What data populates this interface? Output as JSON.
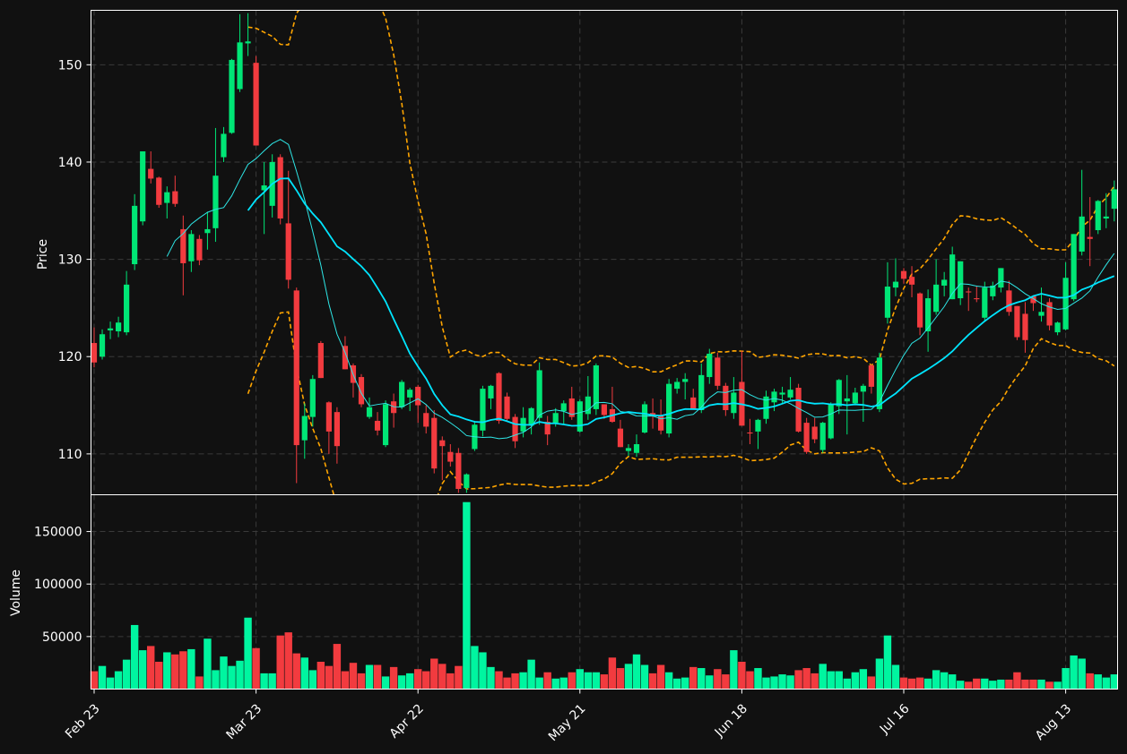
{
  "chart_data": {
    "type": "candlestick",
    "price_panel": {
      "ylabel": "Price",
      "ylim": [
        105.8,
        155.6
      ],
      "yticks": [
        110,
        120,
        130,
        140,
        150
      ],
      "grid": true,
      "overlays": [
        "moving-average-fast",
        "moving-average-slow",
        "bollinger-upper",
        "bollinger-lower"
      ]
    },
    "volume_panel": {
      "ylabel": "Volume",
      "ylim": [
        0,
        185000
      ],
      "yticks": [
        50000,
        100000,
        150000
      ],
      "grid": true
    },
    "x_tick_labels": [
      "Feb 23",
      "Mar 23",
      "Apr 22",
      "May 21",
      "Jun 18",
      "Jul 16",
      "Aug 13"
    ],
    "x_tick_index": [
      0,
      20,
      40,
      60,
      80,
      100,
      120
    ],
    "colors": {
      "background": "#111111",
      "up": "#00e676",
      "up_volume": "#00f5a0",
      "down": "#f23b3f",
      "ma_fast": "#2ee6e6",
      "ma_slow": "#00e5ff",
      "bollinger": "#ffa500",
      "grid": "#3a3a3a",
      "axis": "#ffffff"
    },
    "candles": [
      [
        121.4,
        123.0,
        118.9,
        119.4,
        17000
      ],
      [
        120.0,
        122.8,
        119.7,
        122.3,
        22000
      ],
      [
        122.7,
        123.6,
        121.8,
        122.9,
        11000
      ],
      [
        122.6,
        124.1,
        122.0,
        123.5,
        17000
      ],
      [
        122.5,
        128.8,
        122.2,
        127.4,
        28000
      ],
      [
        129.5,
        136.7,
        128.9,
        135.5,
        61000
      ],
      [
        133.9,
        141.1,
        133.5,
        141.1,
        37000
      ],
      [
        139.3,
        141.1,
        137.8,
        138.3,
        41000
      ],
      [
        138.4,
        138.5,
        135.3,
        135.6,
        26000
      ],
      [
        135.8,
        137.5,
        134.2,
        136.9,
        35000
      ],
      [
        137.0,
        138.6,
        135.4,
        135.7,
        33000
      ],
      [
        133.1,
        134.5,
        126.3,
        129.6,
        36000
      ],
      [
        129.8,
        133.0,
        128.7,
        132.6,
        38000
      ],
      [
        132.1,
        132.5,
        129.4,
        129.9,
        12000
      ],
      [
        132.7,
        134.9,
        131.0,
        133.1,
        48000
      ],
      [
        133.2,
        143.5,
        131.8,
        138.6,
        18000
      ],
      [
        140.5,
        143.6,
        140.0,
        142.9,
        31000
      ],
      [
        143.0,
        150.6,
        142.9,
        150.5,
        22000
      ],
      [
        147.5,
        155.2,
        147.2,
        152.3,
        27000
      ],
      [
        152.2,
        155.3,
        150.9,
        152.4,
        68000
      ],
      [
        150.2,
        150.9,
        141.7,
        141.7,
        39000
      ],
      [
        137.1,
        140.0,
        132.6,
        137.6,
        15000
      ],
      [
        135.5,
        140.8,
        134.3,
        140.0,
        15000
      ],
      [
        140.5,
        140.8,
        133.6,
        134.2,
        51000
      ],
      [
        133.7,
        139.1,
        127.0,
        127.9,
        54000
      ],
      [
        126.8,
        127.1,
        107.0,
        110.9,
        34000
      ],
      [
        111.4,
        115.2,
        109.5,
        113.9,
        30000
      ],
      [
        113.8,
        118.1,
        112.8,
        117.7,
        18000
      ],
      [
        121.4,
        121.6,
        117.8,
        117.8,
        26000
      ],
      [
        115.3,
        115.4,
        110.0,
        112.3,
        22000
      ],
      [
        114.3,
        114.8,
        109.0,
        110.8,
        43000
      ],
      [
        121.1,
        122.1,
        118.7,
        118.7,
        17000
      ],
      [
        119.1,
        119.3,
        115.8,
        117.3,
        25000
      ],
      [
        117.9,
        118.2,
        114.8,
        115.1,
        15000
      ],
      [
        113.8,
        115.8,
        113.6,
        114.8,
        23000
      ],
      [
        113.4,
        114.3,
        111.9,
        112.4,
        23000
      ],
      [
        110.9,
        115.5,
        110.7,
        115.1,
        12000
      ],
      [
        115.4,
        116.2,
        112.7,
        114.2,
        21000
      ],
      [
        114.8,
        117.6,
        114.6,
        117.4,
        13000
      ],
      [
        115.8,
        116.8,
        114.4,
        116.6,
        15000
      ],
      [
        116.9,
        117.1,
        113.2,
        115.0,
        19000
      ],
      [
        114.2,
        115.0,
        112.1,
        112.8,
        17000
      ],
      [
        113.7,
        114.5,
        108.0,
        108.5,
        29000
      ],
      [
        111.4,
        111.8,
        107.3,
        110.8,
        24000
      ],
      [
        110.2,
        111.0,
        108.7,
        109.2,
        15000
      ],
      [
        110.1,
        110.6,
        106.0,
        106.4,
        22000
      ],
      [
        106.5,
        108.0,
        106.0,
        107.9,
        178000
      ],
      [
        110.5,
        113.4,
        110.3,
        113.0,
        41000
      ],
      [
        112.4,
        117.0,
        111.8,
        116.7,
        35000
      ],
      [
        115.7,
        117.1,
        114.6,
        117.0,
        21000
      ],
      [
        118.3,
        118.4,
        113.1,
        113.4,
        17000
      ],
      [
        115.9,
        116.3,
        113.4,
        113.6,
        11000
      ],
      [
        113.8,
        114.1,
        110.6,
        111.3,
        15000
      ],
      [
        112.3,
        114.8,
        111.7,
        113.7,
        16000
      ],
      [
        112.9,
        114.8,
        112.0,
        114.7,
        28000
      ],
      [
        113.7,
        119.4,
        113.0,
        118.6,
        11000
      ],
      [
        113.3,
        113.9,
        110.9,
        112.0,
        16000
      ],
      [
        113.2,
        114.7,
        112.8,
        114.2,
        10000
      ],
      [
        114.4,
        115.5,
        113.0,
        115.2,
        11000
      ],
      [
        115.7,
        116.9,
        113.5,
        113.8,
        16000
      ],
      [
        112.3,
        115.6,
        112.2,
        115.4,
        19000
      ],
      [
        114.1,
        118.0,
        113.5,
        115.9,
        16000
      ],
      [
        114.6,
        119.3,
        114.0,
        119.1,
        16000
      ],
      [
        115.1,
        115.1,
        113.6,
        114.0,
        14000
      ],
      [
        114.6,
        116.9,
        113.2,
        113.3,
        30000
      ],
      [
        112.6,
        113.5,
        110.7,
        110.7,
        20000
      ],
      [
        110.3,
        111.0,
        109.8,
        110.6,
        24000
      ],
      [
        110.1,
        112.0,
        109.7,
        111.0,
        33000
      ],
      [
        112.2,
        115.4,
        112.1,
        115.1,
        23000
      ],
      [
        114.2,
        115.7,
        112.6,
        113.9,
        15000
      ],
      [
        113.9,
        115.6,
        112.0,
        112.4,
        23000
      ],
      [
        112.1,
        117.7,
        111.7,
        117.2,
        16000
      ],
      [
        116.7,
        117.8,
        116.2,
        117.4,
        10000
      ],
      [
        117.4,
        118.3,
        115.6,
        117.7,
        11000
      ],
      [
        115.8,
        116.7,
        114.6,
        114.6,
        21000
      ],
      [
        114.5,
        119.3,
        114.2,
        118.1,
        20000
      ],
      [
        117.9,
        120.8,
        117.2,
        120.3,
        13000
      ],
      [
        119.9,
        120.4,
        116.6,
        117.0,
        19000
      ],
      [
        117.0,
        117.3,
        113.9,
        114.5,
        14000
      ],
      [
        114.2,
        117.9,
        113.6,
        116.3,
        37000
      ],
      [
        117.4,
        120.6,
        112.9,
        112.9,
        26000
      ],
      [
        112.2,
        113.6,
        111.0,
        112.1,
        17000
      ],
      [
        112.3,
        113.6,
        110.5,
        113.5,
        20000
      ],
      [
        113.6,
        116.5,
        113.1,
        115.9,
        11000
      ],
      [
        115.3,
        116.7,
        114.4,
        116.4,
        12000
      ],
      [
        116.1,
        116.9,
        115.1,
        116.3,
        14000
      ],
      [
        115.8,
        117.9,
        115.6,
        116.6,
        13000
      ],
      [
        116.8,
        117.2,
        112.2,
        112.3,
        18000
      ],
      [
        113.2,
        113.7,
        110.0,
        110.2,
        20000
      ],
      [
        112.8,
        113.7,
        111.1,
        111.5,
        15000
      ],
      [
        110.4,
        113.3,
        110.1,
        113.2,
        24000
      ],
      [
        111.6,
        115.3,
        111.5,
        115.1,
        17000
      ],
      [
        114.9,
        117.7,
        114.1,
        117.6,
        17000
      ],
      [
        115.4,
        118.1,
        112.0,
        115.7,
        10000
      ],
      [
        115.2,
        116.8,
        115.0,
        116.3,
        16000
      ],
      [
        116.4,
        117.2,
        113.3,
        117.0,
        19000
      ],
      [
        119.1,
        119.2,
        116.2,
        116.9,
        12000
      ],
      [
        114.6,
        120.4,
        114.3,
        119.9,
        29000
      ],
      [
        124.0,
        129.7,
        123.4,
        127.2,
        51000
      ],
      [
        127.1,
        130.1,
        126.2,
        127.7,
        23000
      ],
      [
        128.8,
        129.1,
        127.5,
        128.0,
        11000
      ],
      [
        128.2,
        129.3,
        126.1,
        127.4,
        10000
      ],
      [
        126.5,
        126.6,
        122.2,
        123.0,
        11000
      ],
      [
        122.6,
        126.9,
        120.5,
        126.0,
        10000
      ],
      [
        124.6,
        130.0,
        124.3,
        127.4,
        18000
      ],
      [
        127.3,
        128.7,
        126.2,
        127.9,
        16000
      ],
      [
        125.9,
        131.3,
        125.9,
        130.5,
        14000
      ],
      [
        126.0,
        129.8,
        125.3,
        129.8,
        8000
      ],
      [
        126.7,
        127.1,
        124.7,
        126.6,
        7000
      ],
      [
        126.0,
        127.3,
        125.6,
        125.9,
        10000
      ],
      [
        124.0,
        127.7,
        123.7,
        127.1,
        10000
      ],
      [
        126.2,
        127.7,
        125.8,
        127.3,
        8000
      ],
      [
        127.1,
        129.1,
        126.6,
        129.1,
        9000
      ],
      [
        126.8,
        127.8,
        124.2,
        124.6,
        9000
      ],
      [
        125.2,
        125.2,
        121.7,
        122.0,
        16000
      ],
      [
        124.4,
        125.6,
        120.4,
        121.7,
        9000
      ],
      [
        126.2,
        126.3,
        124.7,
        125.5,
        9000
      ],
      [
        124.2,
        127.1,
        123.6,
        124.6,
        9000
      ],
      [
        125.6,
        126.0,
        122.7,
        123.2,
        7000
      ],
      [
        122.5,
        123.6,
        122.2,
        123.5,
        7000
      ],
      [
        122.8,
        129.7,
        122.7,
        128.1,
        20000
      ],
      [
        125.9,
        132.6,
        125.7,
        132.6,
        32000
      ],
      [
        130.8,
        139.2,
        130.4,
        134.4,
        29000
      ],
      [
        132.3,
        136.4,
        129.3,
        132.1,
        15000
      ],
      [
        133.0,
        136.1,
        132.6,
        136.0,
        14000
      ],
      [
        134.2,
        136.8,
        133.2,
        134.4,
        11000
      ],
      [
        135.2,
        138.1,
        133.9,
        137.2,
        14000
      ]
    ]
  }
}
